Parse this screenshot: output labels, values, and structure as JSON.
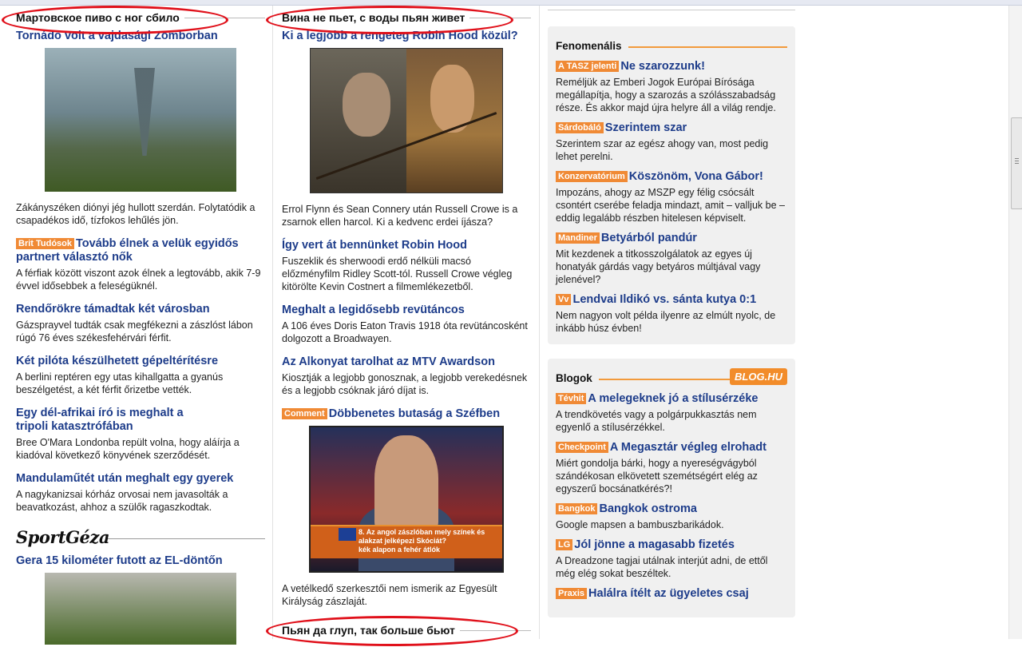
{
  "col1": {
    "section_title": "Мартовское пиво с ног сбило",
    "articles": [
      {
        "title": "Tornádó volt a vajdasági Zomborban",
        "text": "Zákányszéken diónyi jég hullott szerdán. Folytatódik a csapadékos idő, tízfokos lehűlés jön."
      },
      {
        "tag": "Brit Tudósok",
        "title": "Tovább élnek a velük egyidős partnert választó nők",
        "text": "A férfiak között viszont azok élnek a legtovább, akik 7-9 évvel idősebbek a feleségüknél."
      },
      {
        "title": "Rendőrökre támadtak két városban",
        "text": "Gázsprayvel tudták csak megfékezni a zászlóst lábon rúgó 76 éves székesfehérvári férfit."
      },
      {
        "title": "Két pilóta készülhetett gépeltérítésre",
        "text": "A berlini reptéren egy utas kihallgatta a gyanús beszélgetést, a két férfit őrizetbe vették."
      },
      {
        "title": "Egy dél-afrikai író is meghalt a tripoli katasztrófában",
        "text": "Bree O'Mara Londonba repült volna, hogy aláírja a kiadóval következő könyvének szerződését."
      },
      {
        "title": "Mandulaműtét után meghalt egy gyerek",
        "text": "A nagykanizsai kórház orvosai nem javasolták a beavatkozást, ahhoz a szülők ragaszkodtak."
      }
    ],
    "sport_logo": "SportGéza",
    "sport_article_title": "Gera 15 kilométer futott az EL-döntőn"
  },
  "col2": {
    "section_title": "Вина не пьет, с воды пьян живет",
    "articles": [
      {
        "title": "Ki a legjobb a rengeteg Robin Hood közül?",
        "text": "Errol Flynn és Sean Connery után Russell Crowe is a zsarnok ellen harcol. Ki a kedvenc erdei íjásza?"
      },
      {
        "title": "Így vert át bennünket Robin Hood",
        "text": "Fuszeklik és sherwoodi erdő nélküli macsó előzményfilm Ridley Scott-tól. Russell Crowe végleg kitörölte Kevin Costnert a filmemlékezetből."
      },
      {
        "title": "Meghalt a legidősebb revütáncos",
        "text": "A 106 éves Doris Eaton Travis 1918 óta revütáncosként dolgozott a Broadwayen."
      },
      {
        "title": "Az Alkonyat tarolhat az MTV Awardson",
        "text": "Kiosztják a legjobb gonosznak, a legjobb verekedésnek és a legjobb csóknak járó díjat is."
      },
      {
        "tag": "Comment",
        "title": "Döbbenetes butaság a Széfben",
        "text": "A vetélkedő szerkesztői nem ismerik az Egyesült Királyság zászlaját."
      }
    ],
    "quiz_number": "8.",
    "quiz_text": "Az angol zászlóban mely színek és alakzat jelképezi Skóciát?",
    "quiz_answer": "kék alapon a fehér átlók",
    "section2_title": "Пьян да глуп, так больше бьют"
  },
  "col3": {
    "box1": {
      "title": "Fenomenális",
      "items": [
        {
          "tag": "A TASZ jelenti",
          "title": "Ne szarozzunk!",
          "text": "Reméljük az Emberi Jogok Európai Bírósága megállapítja, hogy a szarozás a szólásszabadság része. És akkor majd újra helyre áll a világ rendje."
        },
        {
          "tag": "Sárdobáló",
          "title": "Szerintem szar",
          "text": "Szerintem szar az egész ahogy van, most pedig lehet perelni."
        },
        {
          "tag": "Konzervatórium",
          "title": "Köszönöm, Vona Gábor!",
          "text": "Impozáns, ahogy az MSZP egy félig csócsált csontért cserébe feladja mindazt, amit – valljuk be – eddig legalább részben hitelesen képviselt."
        },
        {
          "tag": "Mandiner",
          "title": "Betyárból pandúr",
          "text": "Mit kezdenek a titkosszolgálatok az egyes új honatyák gárdás vagy betyáros múltjával vagy jelenével?"
        },
        {
          "tag": "Vv",
          "title": "Lendvai Ildikó vs. sánta kutya 0:1",
          "text": "Nem nagyon volt példa ilyenre az elmúlt nyolc, de inkább húsz évben!"
        }
      ]
    },
    "box2": {
      "title": "Blogok",
      "logo": "BLOG.HU",
      "items": [
        {
          "tag": "Tévhit",
          "title": "A melegeknek jó a stílusérzéke",
          "text": "A trendkövetés vagy a polgárpukkasztás nem egyenlő a stílusérzékkel."
        },
        {
          "tag": "Checkpoint",
          "title": "A Megasztár végleg elrohadt",
          "text": "Miért gondolja bárki, hogy a nyereségvágyból szándékosan elkövetett szemétségért elég az egyszerű bocsánatkérés?!"
        },
        {
          "tag": "Bangkok",
          "title": "Bangkok ostroma",
          "text": "Google mapsen a bambuszbarikádok."
        },
        {
          "tag": "LG",
          "title": "Jól jönne a magasabb fizetés",
          "text": "A Dreadzone tagjai utálnak interjút adni, de ettől még elég sokat beszéltek."
        },
        {
          "tag": "Praxis",
          "title": "Halálra ítélt az ügyeletes csaj",
          "text": ""
        }
      ]
    }
  },
  "colors": {
    "link": "#1d3c8a",
    "tag": "#f08a35",
    "annotation": "#e0101a",
    "box_bg": "#f0f0f0"
  }
}
